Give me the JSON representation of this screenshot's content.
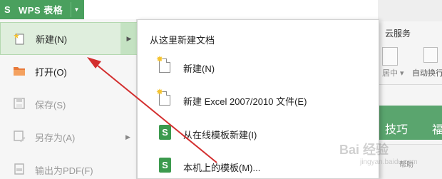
{
  "app": {
    "logo_glyph": "S",
    "title": "WPS 表格",
    "caret": "▼"
  },
  "ribbon": {
    "cloud_tab": "云服务",
    "btn1_label": "居中 ▾",
    "btn2_label": "自动换行",
    "tips_label": "技巧",
    "tips_label2": "福",
    "bottom_label": "帮助"
  },
  "file_menu": {
    "items": [
      {
        "label": "新建(N)",
        "state": "active",
        "icon": "new-file-icon",
        "has_arrow": true
      },
      {
        "label": "打开(O)",
        "state": "normal",
        "icon": "folder-open-icon",
        "has_arrow": false
      },
      {
        "label": "保存(S)",
        "state": "disabled",
        "icon": "save-icon",
        "has_arrow": false
      },
      {
        "label": "另存为(A)",
        "state": "disabled",
        "icon": "save-as-icon",
        "has_arrow": true
      },
      {
        "label": "输出为PDF(F)",
        "state": "disabled",
        "icon": "pdf-icon",
        "has_arrow": false
      }
    ]
  },
  "submenu": {
    "header": "从这里新建文档",
    "items": [
      {
        "label": "新建(N)",
        "icon": "new-doc-icon"
      },
      {
        "label": "新建 Excel 2007/2010 文件(E)",
        "icon": "new-excel-doc-icon"
      },
      {
        "label": "从在线模板新建(I)",
        "icon": "online-template-icon"
      },
      {
        "label": "本机上的模板(M)...",
        "icon": "local-template-icon"
      }
    ]
  },
  "watermark": {
    "text": "Bai 经验",
    "sub": "jingyan.baidu.com"
  },
  "colors": {
    "brand_green": "#4aa05e",
    "active_bg": "#dfeedd",
    "arrow_red": "#d32f2f"
  }
}
